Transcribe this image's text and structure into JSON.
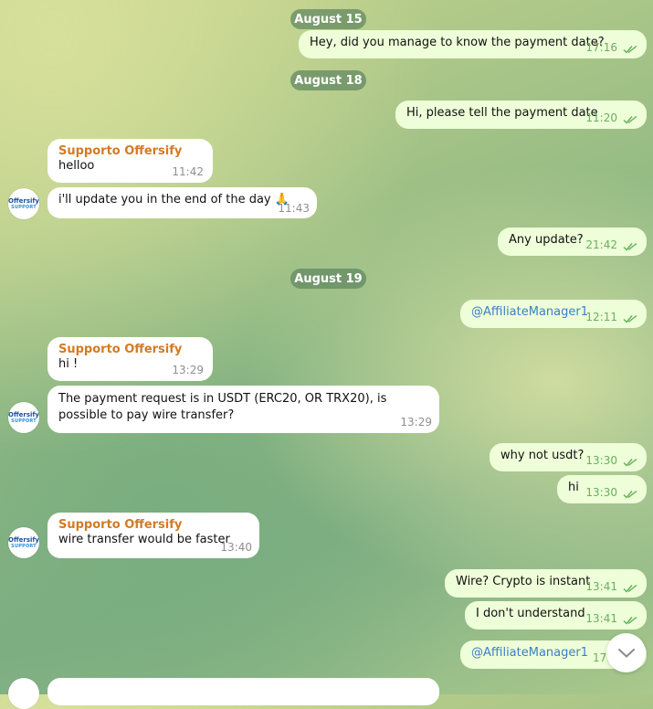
{
  "dates": [
    "August 15",
    "August 18",
    "August 19"
  ],
  "avatar": {
    "line1": "Offersify",
    "line2": "SUPPORT"
  },
  "messages": [
    {
      "text": "Hey, did you manage to know the payment date?",
      "time": "17:16"
    },
    {
      "text": "Hi, please tell the payment date",
      "time": "11:20"
    },
    {
      "sender": "Supporto Offersify",
      "text": "helloo",
      "time": "11:42"
    },
    {
      "text": "i'll update you in the end of the day 🙏",
      "time": "11:43"
    },
    {
      "text": "Any update?",
      "time": "21:42"
    },
    {
      "text": "@AffiliateManager1",
      "time": "12:11"
    },
    {
      "sender": "Supporto Offersify",
      "text": "hi !",
      "time": "13:29"
    },
    {
      "text": "The payment request is in USDT (ERC20, OR TRX20), is possible to pay wire transfer?",
      "time": "13:29"
    },
    {
      "text": "why not usdt?",
      "time": "13:30"
    },
    {
      "text": "hi",
      "time": "13:30"
    },
    {
      "sender": "Supporto Offersify",
      "text": "wire transfer would be faster",
      "time": "13:40"
    },
    {
      "text": "Wire? Crypto is instant",
      "time": "13:41"
    },
    {
      "text": "I don't understand",
      "time": "13:41"
    },
    {
      "text": "@AffiliateManager1",
      "time": "17:2"
    }
  ]
}
